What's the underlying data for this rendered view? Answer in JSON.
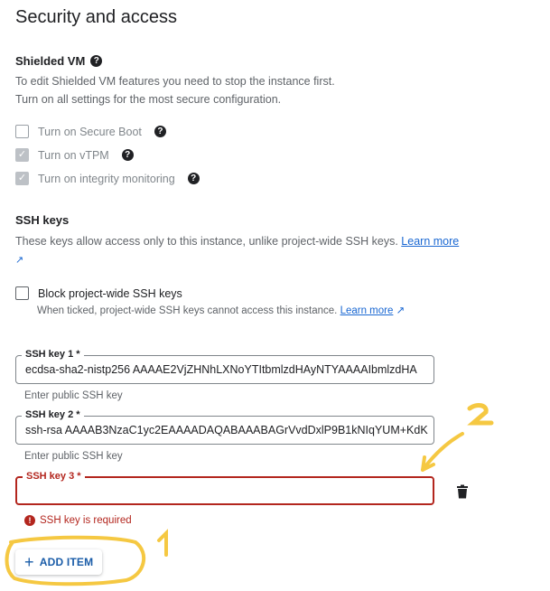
{
  "section_title": "Security and access",
  "shielded_vm": {
    "heading": "Shielded VM",
    "desc_line1": "To edit Shielded VM features you need to stop the instance first.",
    "desc_line2": "Turn on all settings for the most secure configuration.",
    "options": [
      {
        "label": "Turn on Secure Boot",
        "checked": false
      },
      {
        "label": "Turn on vTPM",
        "checked": true
      },
      {
        "label": "Turn on integrity monitoring",
        "checked": true
      }
    ]
  },
  "ssh_keys": {
    "heading": "SSH keys",
    "desc": "These keys allow access only to this instance, unlike project-wide SSH keys.",
    "learn_more": "Learn more",
    "block_label": "Block project-wide SSH keys",
    "block_desc": "When ticked, project-wide SSH keys cannot access this instance.",
    "block_learn_more": "Learn more",
    "keys": [
      {
        "label": "SSH key 1 *",
        "value": "ecdsa-sha2-nistp256 AAAAE2VjZHNhLXNoYTItbmlzdHAyNTYAAAAIbmlzdHA",
        "hint": "Enter public SSH key"
      },
      {
        "label": "SSH key 2 *",
        "value": "ssh-rsa AAAAB3NzaC1yc2EAAAADAQABAAABAGrVvdDxlP9B1kNIqYUM+KdK",
        "hint": "Enter public SSH key"
      },
      {
        "label": "SSH key 3 *",
        "value": "",
        "error": "SSH key is required"
      }
    ],
    "add_item": "ADD ITEM"
  },
  "annotations": {
    "mark1": "1",
    "mark2": "2",
    "color": "#f5c842"
  }
}
